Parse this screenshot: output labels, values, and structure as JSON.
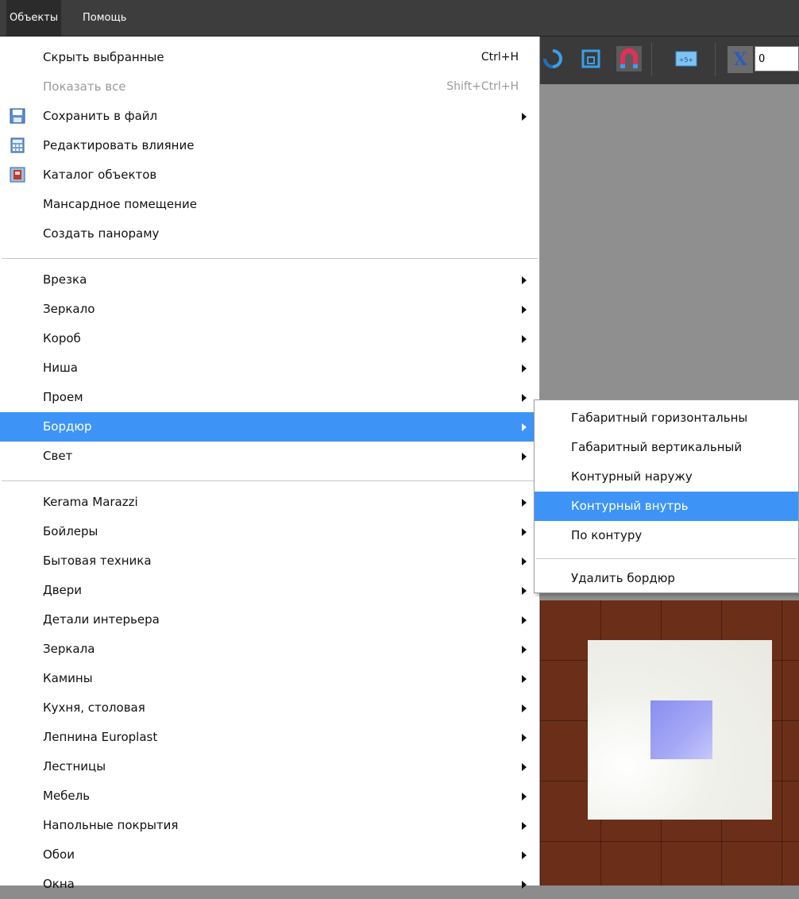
{
  "menubar": {
    "items": [
      "Объекты",
      "Помощь"
    ]
  },
  "toolbar": {
    "coord_label": "X",
    "coord_value": "0",
    "tape_icon_text": "+5+"
  },
  "main_menu": {
    "group1": [
      {
        "label": "Скрыть выбранные",
        "shortcut": "Ctrl+H"
      },
      {
        "label": "Показать все",
        "shortcut": "Shift+Ctrl+H",
        "disabled": true
      },
      {
        "label": "Сохранить в файл",
        "icon": "save-icon",
        "submenu": true
      },
      {
        "label": "Редактировать влияние",
        "icon": "calculator-icon"
      },
      {
        "label": "Каталог объектов",
        "icon": "catalog-icon"
      },
      {
        "label": "Мансардное помещение"
      },
      {
        "label": "Создать панораму"
      }
    ],
    "group2": [
      {
        "label": "Врезка",
        "submenu": true
      },
      {
        "label": "Зеркало",
        "submenu": true
      },
      {
        "label": "Короб",
        "submenu": true
      },
      {
        "label": "Ниша",
        "submenu": true
      },
      {
        "label": "Проем",
        "submenu": true
      },
      {
        "label": "Бордюр",
        "submenu": true,
        "highlighted": true
      },
      {
        "label": "Свет",
        "submenu": true
      }
    ],
    "group3": [
      {
        "label": "Kerama Marazzi"
      },
      {
        "label": "Бойлеры"
      },
      {
        "label": "Бытовая техника"
      },
      {
        "label": "Двери"
      },
      {
        "label": "Детали интерьера"
      },
      {
        "label": "Зеркала"
      },
      {
        "label": "Камины"
      },
      {
        "label": "Кухня, столовая"
      },
      {
        "label": "Лепнина Europlast"
      },
      {
        "label": "Лестницы"
      },
      {
        "label": "Мебель"
      },
      {
        "label": "Напольные покрытия"
      },
      {
        "label": "Обои"
      },
      {
        "label": "Окна"
      }
    ]
  },
  "sub_menu": {
    "items": [
      {
        "label": "Габаритный горизонтальны"
      },
      {
        "label": "Габаритный вертикальный"
      },
      {
        "label": "Контурный наружу"
      },
      {
        "label": "Контурный внутрь",
        "highlighted": true
      },
      {
        "label": "По контуру"
      }
    ],
    "delete_label": "Удалить бордюр"
  },
  "colors": {
    "highlight": "#3d94f6",
    "menubar": "#3d3d3d",
    "floor": "#6b2e18"
  }
}
